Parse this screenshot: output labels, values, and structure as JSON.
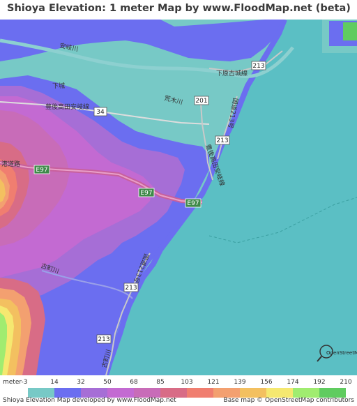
{
  "title": "Shioya Elevation: 1 meter Map by www.FloodMap.net (beta)",
  "map": {
    "road_labels": [
      {
        "text": "213",
        "id": "route-213-north"
      },
      {
        "text": "201",
        "id": "route-201"
      },
      {
        "text": "34",
        "id": "route-34"
      },
      {
        "text": "213",
        "id": "route-213-east"
      },
      {
        "text": "E97",
        "id": "e97-west"
      },
      {
        "text": "E97",
        "id": "e97-center"
      },
      {
        "text": "E97",
        "id": "e97-east"
      },
      {
        "text": "213",
        "id": "route-213-south"
      },
      {
        "text": "213",
        "id": "route-213-far-south"
      }
    ],
    "place_labels": [
      {
        "text": "下城",
        "id": "label-shimojo"
      },
      {
        "text": "豊後高田安岐線",
        "id": "label-bungotakada-line"
      },
      {
        "text": "安岐川",
        "id": "label-aki-river"
      },
      {
        "text": "荒木川",
        "id": "label-araki-river"
      },
      {
        "text": "下原古城線",
        "id": "label-shimohara-line"
      },
      {
        "text": "豊後高田安岐線",
        "id": "label-bungotakada-line-vertical"
      },
      {
        "text": "国道213号",
        "id": "label-route213-north"
      },
      {
        "text": "国道213号",
        "id": "label-route213-south"
      },
      {
        "text": "古町川",
        "id": "label-furumachi-river"
      },
      {
        "text": "古町川",
        "id": "label-furumachi-river-south"
      },
      {
        "text": "港道路",
        "id": "label-airport-road"
      }
    ],
    "colors": {
      "sea": "#5bbfc4",
      "lowland": "#77c9c6",
      "blue": "#6b6ef0",
      "purple": "#a66ed6",
      "magenta": "#c86cc8",
      "pink": "#d070a0",
      "salmon": "#e98078",
      "orange": "#f0a070",
      "gold": "#f3c060",
      "yellow": "#f5e870",
      "lightgreen": "#a0ec70",
      "green": "#60cc60"
    }
  },
  "legend": {
    "unit": "meter",
    "labels": [
      "-3",
      "14",
      "32",
      "50",
      "68",
      "85",
      "103",
      "121",
      "139",
      "156",
      "174",
      "192",
      "210"
    ],
    "colors": [
      "#77c9c6",
      "#6b6ef0",
      "#a66ed6",
      "#c36ad2",
      "#c86cb8",
      "#d86c86",
      "#f07e70",
      "#f3a070",
      "#f3c060",
      "#f5e870",
      "#a0ec70",
      "#60cc60"
    ]
  },
  "footer": {
    "left": "Shioya Elevation Map developed by www.FloodMap.net",
    "right": "Base map © OpenStreetMap contributors"
  },
  "osm_logo_text": "OpenStreetMap"
}
